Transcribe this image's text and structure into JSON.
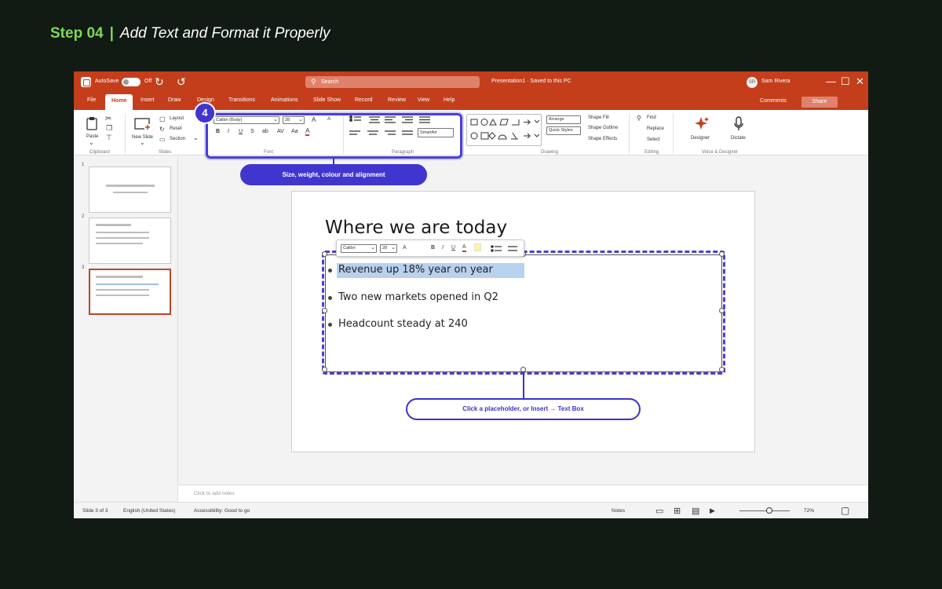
{
  "step": {
    "number": "Step 04",
    "separator": "|",
    "title": "Add Text and Format it Properly"
  },
  "titlebar": {
    "autosave": "AutoSave",
    "toggle_state": "Off",
    "search_placeholder": "Search",
    "document": "Presentation1 · Saved to this PC",
    "avatar": "SR",
    "user": "Sam Rivera"
  },
  "tabs": [
    "File",
    "Home",
    "Insert",
    "Draw",
    "Design",
    "Transitions",
    "Animations",
    "Slide Show",
    "Record",
    "Review",
    "View",
    "Help"
  ],
  "tab_right": {
    "comments": "Comments",
    "share": "Share"
  },
  "ribbon": {
    "clipboard": {
      "paste": "Paste",
      "label": "Clipboard"
    },
    "slides": {
      "new_slide": "New Slide",
      "layout": "Layout",
      "reset": "Reset",
      "section": "Section",
      "label": "Slides"
    },
    "font": {
      "family": "Calibri (Body)",
      "size": "28",
      "grow": "A",
      "shrink": "A",
      "bold": "B",
      "italic": "I",
      "underline": "U",
      "strike": "S",
      "sub": "ab",
      "spacing": "AV",
      "case": "Aa",
      "color": "A",
      "label": "Font"
    },
    "paragraph": {
      "smartart": "SmartArt",
      "label": "Paragraph"
    },
    "drawing": {
      "arrange": "Arrange",
      "quick_styles": "Quick Styles",
      "shape_fill": "Shape Fill",
      "shape_outline": "Shape Outline",
      "shape_effects": "Shape Effects",
      "label": "Drawing"
    },
    "editing": {
      "find": "Find",
      "replace": "Replace",
      "select": "Select",
      "label": "Editing"
    },
    "voice": {
      "designer": "Designer",
      "dictate": "Dictate",
      "label": "Voice & Designer"
    }
  },
  "thumbs": [
    "1",
    "2",
    "3"
  ],
  "slide": {
    "title": "Where we are today",
    "bullets": [
      "Revenue up 18% year on year",
      "Two new markets opened in Q2",
      "Headcount steady at 240"
    ],
    "mini_toolbar": {
      "font": "Calibri",
      "size": "28",
      "grow": "A",
      "bold": "B",
      "italic": "I",
      "underline": "U",
      "color": "A"
    }
  },
  "annotations": {
    "badge": "4",
    "ribbon_callout": "Size, weight, colour and alignment",
    "placeholder_callout": "Click a placeholder, or Insert → Text Box"
  },
  "notes_placeholder": "Click to add notes",
  "status": {
    "slide": "Slide 3 of 3",
    "language": "English (United States)",
    "accessibility": "Accessibility: Good to go",
    "notes": "Notes",
    "zoom": "72%",
    "zoom_level": 0.6
  },
  "colors": {
    "accent": "#c43e1c",
    "annotation": "#3d32c9",
    "step": "#7ed957"
  }
}
